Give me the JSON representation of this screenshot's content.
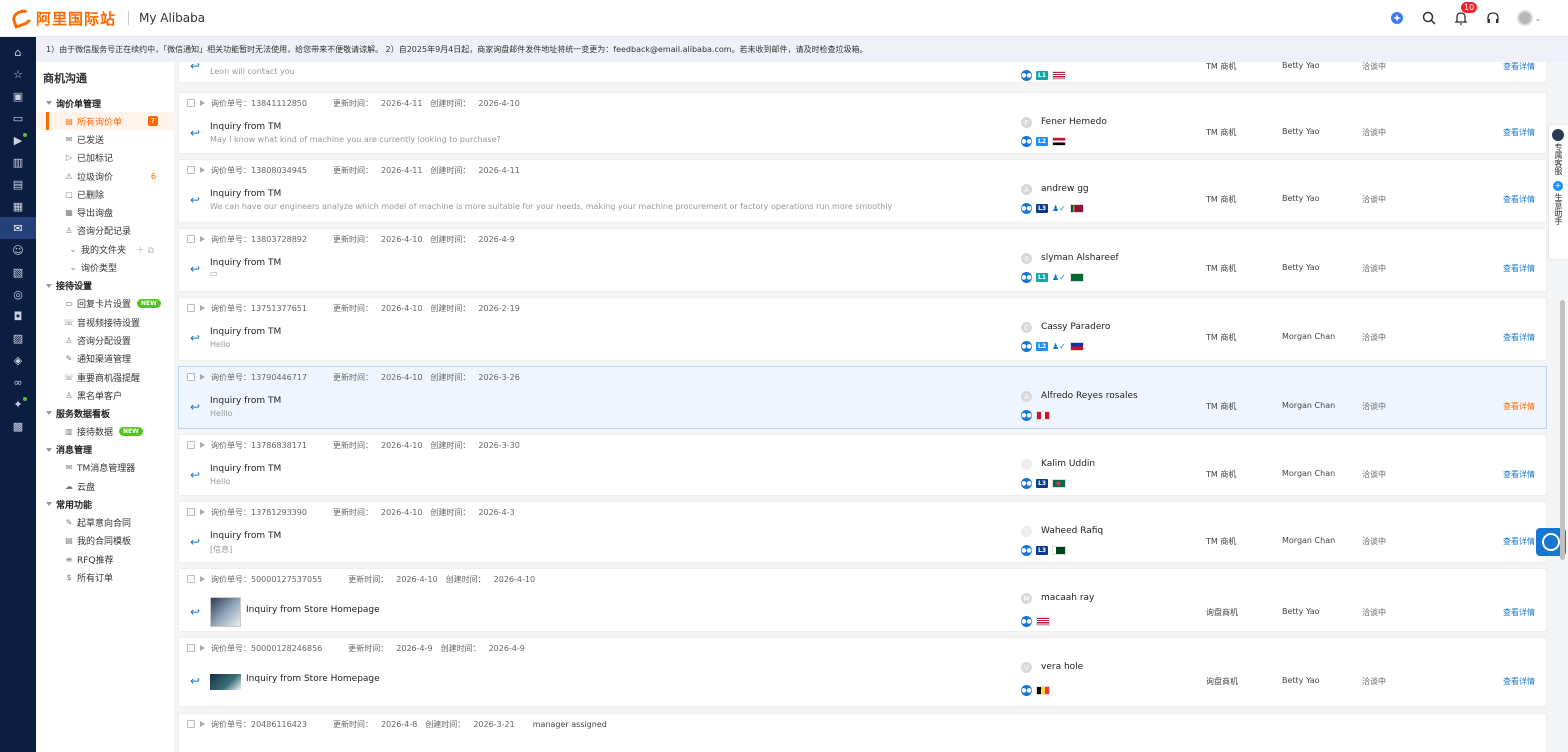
{
  "header": {
    "logo_text": "阿里国际站",
    "app_title": "My Alibaba",
    "notification_count": "10"
  },
  "notice": "1）由于微信服务号正在续约中，「微信通知」相关功能暂时无法使用，给您带来不便敬请谅解。 2）自2025年9月4日起，商家询盘邮件发件地址将统一变更为：feedback@email.alibaba.com。若未收到邮件，请及时检查垃圾箱。",
  "sidebar": {
    "title": "商机沟通",
    "groups": [
      {
        "label": "询价单管理",
        "items": [
          {
            "label": "所有询价单",
            "icon": "inbox-icon",
            "badge": "7",
            "active": true
          },
          {
            "label": "已发送",
            "icon": "send-icon"
          },
          {
            "label": "已加标记",
            "icon": "flag-icon"
          },
          {
            "label": "垃圾询价",
            "icon": "warning-icon",
            "count": "6"
          },
          {
            "label": "已删除",
            "icon": "trash-icon"
          },
          {
            "label": "导出询盘",
            "icon": "export-icon"
          },
          {
            "label": "咨询分配记录",
            "icon": "user-icon"
          },
          {
            "label": "我的文件夹",
            "icon": "chevron-down-icon",
            "sub": true,
            "folder_actions": "＋ ⧉"
          },
          {
            "label": "询价类型",
            "icon": "chevron-down-icon",
            "sub": true
          }
        ]
      },
      {
        "label": "接待设置",
        "items": [
          {
            "label": "回复卡片设置",
            "icon": "card-icon",
            "new": "NEW"
          },
          {
            "label": "音视频接待设置",
            "icon": "phone-icon"
          },
          {
            "label": "咨询分配设置",
            "icon": "user-icon"
          },
          {
            "label": "通知渠道管理",
            "icon": "edit-icon"
          },
          {
            "label": "重要商机强提醒",
            "icon": "phone-icon"
          },
          {
            "label": "黑名单客户",
            "icon": "user-block-icon"
          }
        ]
      },
      {
        "label": "服务数据看板",
        "items": [
          {
            "label": "接待数据",
            "icon": "chart-icon",
            "new": "NEW"
          }
        ]
      },
      {
        "label": "消息管理",
        "items": [
          {
            "label": "TM消息管理器",
            "icon": "message-icon"
          },
          {
            "label": "云盘",
            "icon": "cloud-icon"
          }
        ]
      },
      {
        "label": "常用功能",
        "items": [
          {
            "label": "起草意向合同",
            "icon": "contract-icon"
          },
          {
            "label": "我的合同模板",
            "icon": "template-icon"
          },
          {
            "label": "RFQ推荐",
            "icon": "rfq-icon"
          },
          {
            "label": "所有订单",
            "icon": "dollar-icon"
          }
        ]
      }
    ]
  },
  "list": {
    "labels": {
      "inquiry_no": "询价单号：",
      "updated": "更新时间：",
      "created": "创建时间：",
      "view": "查看详情"
    },
    "partial_top": {
      "preview": "Leon will contact you",
      "level": "L1",
      "source": "TM 商机",
      "owner": "Betty Yao",
      "status": "洽谈中",
      "view": "查看详情"
    },
    "rows": [
      {
        "no": "13841112850",
        "updated": "2026-4-11",
        "created": "2026-4-10",
        "subject": "Inquiry from TM",
        "preview": "May I know what kind of machine you are currently looking to purchase?",
        "initial": "F",
        "buyer": "Fener Hemedo",
        "level": "L2",
        "person": false,
        "flag": "egypt",
        "source": "TM 商机",
        "owner": "Betty Yao",
        "status": "洽谈中"
      },
      {
        "no": "13808034945",
        "updated": "2026-4-11",
        "created": "2026-4-11",
        "subject": "Inquiry from TM",
        "preview": "We can have our engineers analyze which model of machine is more suitable for your needs, making your machine procurement or factory operations run more smoothly",
        "initial": "A",
        "buyer": "andrew gg",
        "level": "L3",
        "person": true,
        "flag": "srilanka",
        "source": "TM 商机",
        "owner": "Betty Yao",
        "status": "洽谈中"
      },
      {
        "no": "13803728892",
        "updated": "2026-4-10",
        "created": "2026-4-9",
        "subject": "Inquiry from TM",
        "preview": "",
        "initial": "S",
        "buyer": "slyman Alshareef",
        "level": "L1",
        "person": true,
        "flag": "saudi",
        "source": "TM 商机",
        "owner": "Betty Yao",
        "status": "洽谈中"
      },
      {
        "no": "13751377651",
        "updated": "2026-4-10",
        "created": "2026-2-19",
        "subject": "Inquiry from TM",
        "preview": "Hello",
        "initial": "C",
        "buyer": "Cassy Paradero",
        "level": "L2",
        "person": true,
        "flag": "philippines",
        "source": "TM 商机",
        "owner": "Morgan Chan",
        "status": "洽谈中"
      },
      {
        "no": "13790446717",
        "updated": "2026-4-10",
        "created": "2026-3-26",
        "subject": "Inquiry from TM",
        "preview": "Helllo",
        "initial": "A",
        "buyer": "Alfredo Reyes rosales",
        "level": "",
        "person": false,
        "flag": "peru",
        "source": "TM 商机",
        "owner": "Morgan Chan",
        "status": "洽谈中",
        "highlight": true
      },
      {
        "no": "13786838171",
        "updated": "2026-4-10",
        "created": "2026-3-30",
        "subject": "Inquiry from TM",
        "preview": "Hello",
        "initial": "",
        "buyer": "Kalim Uddin",
        "level": "L3",
        "person": false,
        "flag": "bangladesh",
        "source": "TM 商机",
        "owner": "Morgan Chan",
        "status": "洽谈中"
      },
      {
        "no": "13781293390",
        "updated": "2026-4-10",
        "created": "2026-4-3",
        "subject": "Inquiry from TM",
        "preview": "[信息]",
        "initial": "",
        "buyer": "Waheed Rafiq",
        "level": "L3",
        "person": false,
        "flag": "pakistan",
        "source": "TM 商机",
        "owner": "Morgan Chan",
        "status": "洽谈中"
      },
      {
        "no": "50000127537055",
        "updated": "2026-4-10",
        "created": "2026-4-10",
        "subject": "Inquiry from Store Homepage",
        "preview": "",
        "thumb": true,
        "initial": "M",
        "buyer": "macaah ray",
        "level": "",
        "person": false,
        "flag": "usa",
        "source": "询盘商机",
        "owner": "Betty Yao",
        "status": "洽谈中"
      },
      {
        "no": "50000128246856",
        "updated": "2026-4-9",
        "created": "2026-4-9",
        "subject": "Inquiry from Store Homepage",
        "preview": "",
        "thumb": true,
        "initial": "V",
        "buyer": "vera hole",
        "level": "",
        "person": false,
        "flag": "belgium",
        "source": "询盘商机",
        "owner": "Betty Yao",
        "status": "洽谈中"
      },
      {
        "no": "20486116423",
        "updated": "2026-4-8",
        "created": "2026-3-21",
        "extra": "manager assigned"
      }
    ]
  },
  "float_panel": {
    "service": "专属客服",
    "assistant": "生意助手"
  },
  "colors": {
    "brand": "#ff6a00",
    "rail": "#0b1e3f",
    "link": "#1677d2"
  }
}
